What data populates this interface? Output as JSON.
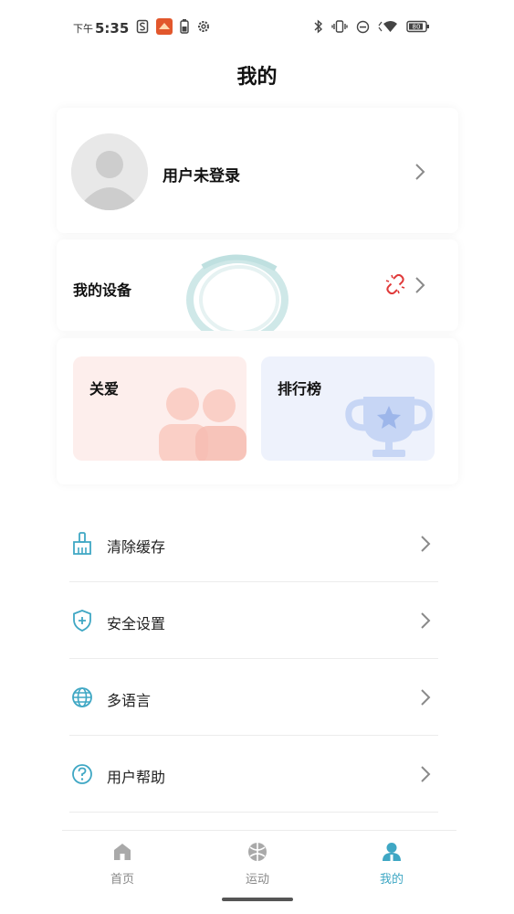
{
  "status_bar": {
    "ampm": "下午",
    "time": "5:35",
    "battery_level": "80"
  },
  "page": {
    "title": "我的"
  },
  "profile": {
    "username": "用户未登录"
  },
  "device": {
    "label": "我的设备"
  },
  "features": {
    "care_label": "关爱",
    "ranking_label": "排行榜"
  },
  "menu": [
    {
      "label": "清除缓存",
      "icon": "broom-icon"
    },
    {
      "label": "安全设置",
      "icon": "shield-plus-icon"
    },
    {
      "label": "多语言",
      "icon": "globe-icon"
    },
    {
      "label": "用户帮助",
      "icon": "help-circle-icon"
    }
  ],
  "tabs": [
    {
      "label": "首页",
      "icon": "home-icon"
    },
    {
      "label": "运动",
      "icon": "sport-ball-icon"
    },
    {
      "label": "我的",
      "icon": "person-icon"
    }
  ],
  "colors": {
    "accent": "#3fa7c4",
    "link_broken": "#e03a3a",
    "care_bg": "#fdeeec",
    "rank_bg": "#eef2fc"
  }
}
